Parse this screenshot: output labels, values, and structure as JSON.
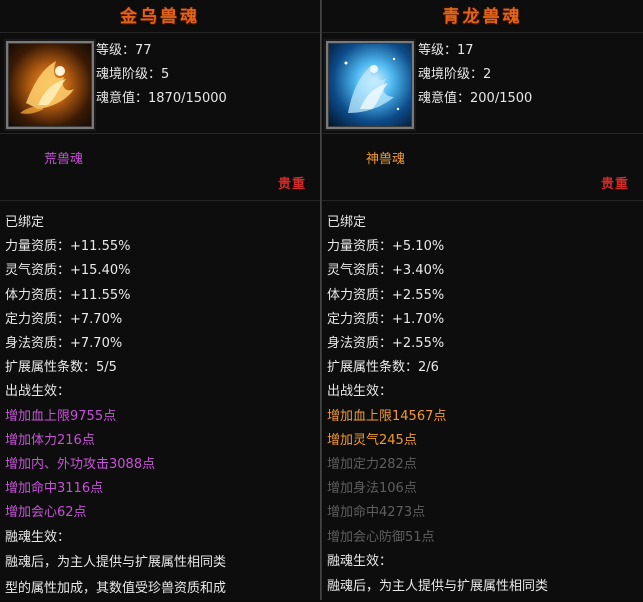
{
  "left": {
    "title": "金乌兽魂",
    "level_label": "等级：77",
    "realm_label": "魂境阶级：5",
    "soul_value_label": "魂意值：1870/15000",
    "type_label": "荒兽魂",
    "rarity_label": "贵重",
    "bound_label": "已绑定",
    "attributes": [
      "力量资质：+11.55%",
      "灵气资质：+15.40%",
      "体力资质：+11.55%",
      "定力资质：+7.70%",
      "身法资质：+7.70%"
    ],
    "extend_label": "扩展属性条数：5/5",
    "battle_effect_label": "出战生效：",
    "effects": [
      "增加血上限9755点",
      "增加体力216点",
      "增加内、外功攻击3088点",
      "增加命中3116点",
      "增加会心62点"
    ],
    "merge_label": "融魂生效：",
    "merge_desc_1": "融魂后，为主人提供与扩展属性相同类",
    "merge_desc_2": "型的属性加成，其数值受珍兽资质和成"
  },
  "right": {
    "title": "青龙兽魂",
    "level_label": "等级：17",
    "realm_label": "魂境阶级：2",
    "soul_value_label": "魂意值：200/1500",
    "type_label": "神兽魂",
    "rarity_label": "贵重",
    "bound_label": "已绑定",
    "attributes": [
      "力量资质：+5.10%",
      "灵气资质：+3.40%",
      "体力资质：+2.55%",
      "定力资质：+1.70%",
      "身法资质：+2.55%"
    ],
    "extend_label": "扩展属性条数：2/6",
    "battle_effect_label": "出战生效：",
    "active_effects": [
      "增加血上限14567点",
      "增加灵气245点"
    ],
    "inactive_effects": [
      "增加定力282点",
      "增加身法106点",
      "增加命中4273点",
      "增加会心防御51点"
    ],
    "merge_label": "融魂生效：",
    "merge_desc_1": "融魂后，为主人提供与扩展属性相同类"
  },
  "colors": {
    "title": "#e0651a",
    "huang_type": "#c74fd8",
    "shen_type": "#f09a2a",
    "rarity": "#d42a2a",
    "active_effect_left": "#c752d8",
    "active_effect_right": "#f39a2c",
    "inactive_effect": "#5e5e5e"
  },
  "icons": {
    "left": "golden-crow-icon",
    "right": "azure-dragon-icon"
  }
}
